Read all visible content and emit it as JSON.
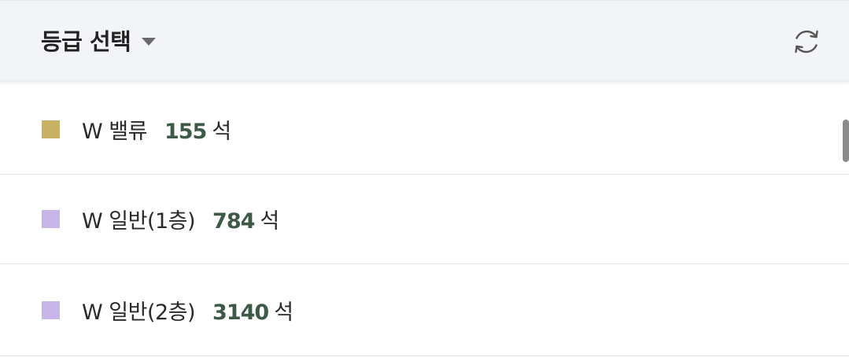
{
  "header": {
    "title": "등급 선택",
    "icons": {
      "caret": "chevron-down-icon",
      "refresh": "refresh-icon"
    }
  },
  "grades": [
    {
      "label": "W 밸류",
      "count": "155",
      "unit": "석",
      "color": "#c8b065"
    },
    {
      "label": "W 일반(1층)",
      "count": "784",
      "unit": "석",
      "color": "#c8b5e8"
    },
    {
      "label": "W 일반(2층)",
      "count": "3140",
      "unit": "석",
      "color": "#c8b5e8"
    }
  ],
  "colors": {
    "header_bg": "#f3f4f7",
    "count_text": "#3d5a47",
    "divider": "#e5e5e5"
  }
}
